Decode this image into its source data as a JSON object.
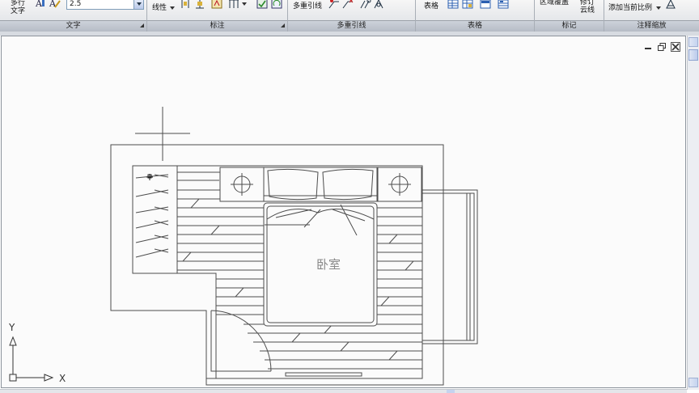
{
  "ribbon": {
    "panels": [
      {
        "title": "文字",
        "has_launcher": true
      },
      {
        "title": "标注",
        "has_launcher": true
      },
      {
        "title": "多重引线",
        "has_launcher": false
      },
      {
        "title": "表格",
        "has_launcher": false
      },
      {
        "title": "标记",
        "has_launcher": false
      },
      {
        "title": "注释缩放",
        "has_launcher": false
      }
    ],
    "text": {
      "multiline_line1": "多行",
      "multiline_line2": "文字",
      "height_value": "2.5"
    },
    "dimension": {
      "linear_label": "线性"
    },
    "multileader": {
      "label": "多重引线"
    },
    "table": {
      "label": "表格"
    },
    "markup": {
      "wipeout_label": "区域覆盖",
      "revcloud_line1": "修订",
      "revcloud_line2": "云线"
    },
    "annoscale": {
      "add_scale_label": "添加当前比例"
    }
  },
  "drawing": {
    "room_label": "卧室",
    "ucs_x_label": "X",
    "ucs_y_label": "Y"
  },
  "icons": [
    "text-style-icon",
    "text-edit-icon",
    "dimension-icons",
    "leader-icons",
    "table-icons",
    "minimize-icon",
    "restore-icon",
    "close-icon"
  ],
  "colors": {
    "line": "#4a4a4a",
    "canvas": "#fbfbfb",
    "ribbon_title": "#b6bcc6"
  }
}
